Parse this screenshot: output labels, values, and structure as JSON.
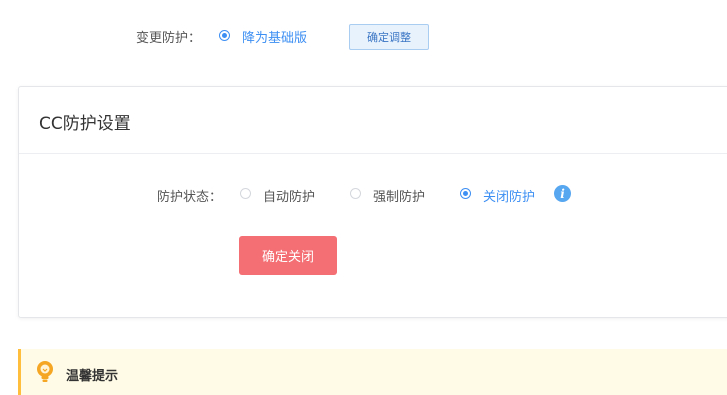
{
  "change_protection": {
    "label": "变更防护：",
    "option_label": "降为基础版",
    "confirm_button": "确定调整"
  },
  "cc_settings": {
    "title": "CC防护设置",
    "status_label": "防护状态：",
    "options": [
      {
        "label": "自动防护",
        "checked": false
      },
      {
        "label": "强制防护",
        "checked": false
      },
      {
        "label": "关闭防护",
        "checked": true
      }
    ],
    "info_icon_glyph": "i",
    "confirm_button": "确定关闭"
  },
  "tip": {
    "title": "温馨提示"
  },
  "colors": {
    "accent": "#3d8ff3",
    "danger_button": "#f36f73",
    "tip_background": "#fffbe6",
    "tip_border": "#ffbf3c"
  }
}
